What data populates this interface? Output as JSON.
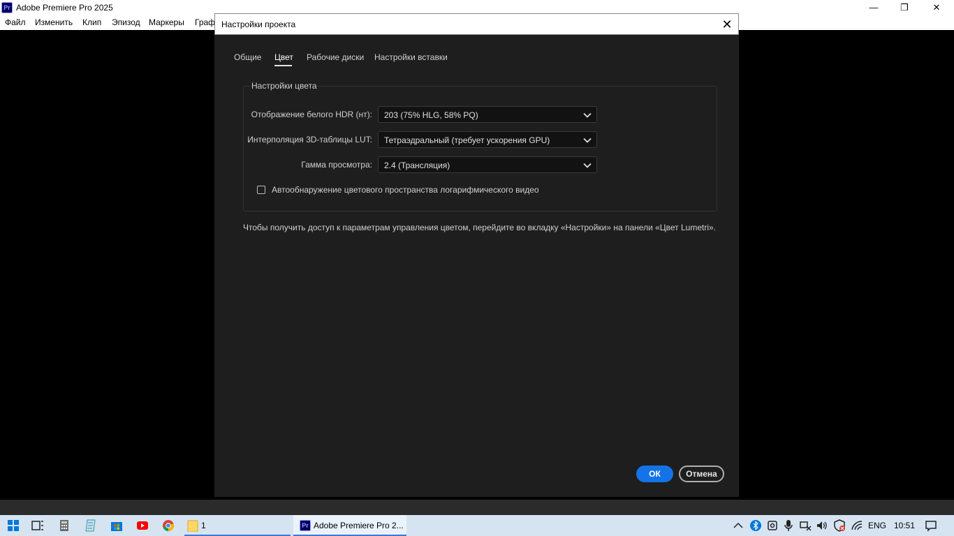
{
  "app": {
    "title": "Adobe Premiere Pro 2025",
    "icon_text": "Pr",
    "window_buttons": {
      "minimize": "—",
      "restore": "❐",
      "close": "✕"
    }
  },
  "menu": {
    "items": [
      "Файл",
      "Изменить",
      "Клип",
      "Эпизод",
      "Маркеры",
      "Граф"
    ]
  },
  "dialog": {
    "title": "Настройки проекта",
    "close_glyph": "✕",
    "tabs": [
      {
        "label": "Общие",
        "active": false
      },
      {
        "label": "Цвет",
        "active": true
      },
      {
        "label": "Рабочие диски",
        "active": false
      },
      {
        "label": "Настройки вставки",
        "active": false
      }
    ],
    "group_title": "Настройки цвета",
    "fields": [
      {
        "label": "Отображение белого HDR (нт):",
        "value": "203 (75% HLG, 58% PQ)"
      },
      {
        "label": "Интерполяция 3D-таблицы LUT:",
        "value": "Тетраэдральный (требует ускорения GPU)"
      },
      {
        "label": "Гамма просмотра:",
        "value": "2.4 (Трансляция)"
      }
    ],
    "checkbox": {
      "label": "Автообнаружение цветового пространства логарифмического видео",
      "checked": false
    },
    "info_text": "Чтобы получить доступ к параметрам управления цветом, перейдите во вкладку «Настройки» на панели «Цвет Lumetri».",
    "ok_label": "ОК",
    "cancel_label": "Отмена"
  },
  "taskbar": {
    "explorer_label": "1",
    "premiere_label": "Adobe Premiere Pro 2...",
    "premiere_icon_text": "Pr",
    "tray_lang": "ENG",
    "tray_time": "10:51",
    "icons": [
      "windows-start-icon",
      "task-view-icon",
      "calculator-icon",
      "notepad-icon",
      "store-icon",
      "youtube-icon",
      "chrome-icon",
      "file-explorer-icon"
    ]
  },
  "colors": {
    "dialog_bg": "#1e1e1e",
    "accent": "#1473e6",
    "taskbar": "#d6e4f2"
  }
}
